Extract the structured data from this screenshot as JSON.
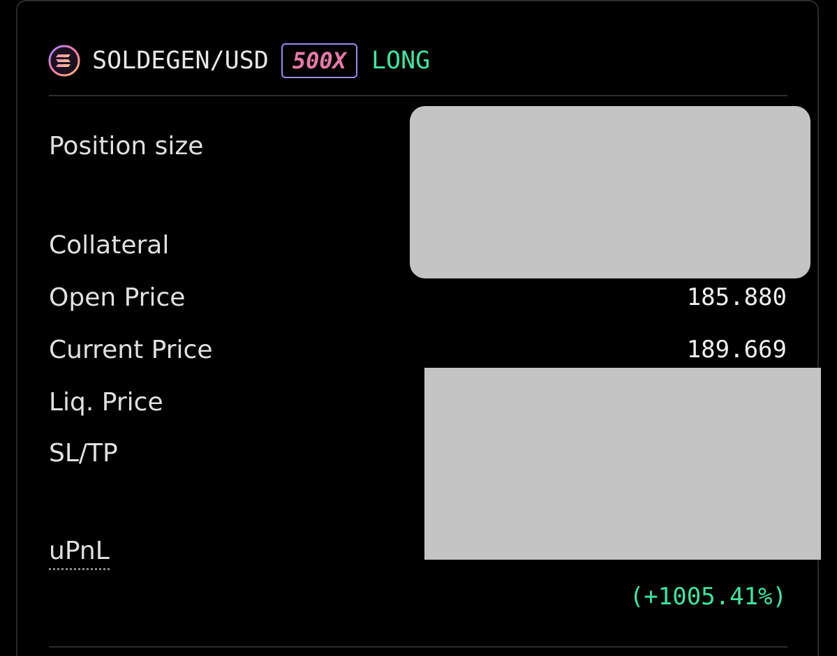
{
  "header": {
    "pair": "SOLDEGEN/USD",
    "leverage": "500X",
    "side": "LONG",
    "coin_icon": "solana-icon"
  },
  "rows": {
    "position_size": {
      "label": "Position size"
    },
    "collateral": {
      "label": "Collateral"
    },
    "open_price": {
      "label": "Open Price",
      "value": "185.880"
    },
    "current_price": {
      "label": "Current Price",
      "value": "189.669"
    },
    "liq_price": {
      "label": "Liq. Price"
    },
    "sl_tp": {
      "label": "SL/TP"
    },
    "upnl": {
      "label": "uPnL",
      "percent": "(+1005.41%)"
    }
  },
  "colors": {
    "background": "#000000",
    "text": "#e0e0e0",
    "positive": "#3ee6a0",
    "leverage_text": "#e77aa6",
    "leverage_border": "#9a8cf0",
    "redaction": "#c4c4c4"
  }
}
